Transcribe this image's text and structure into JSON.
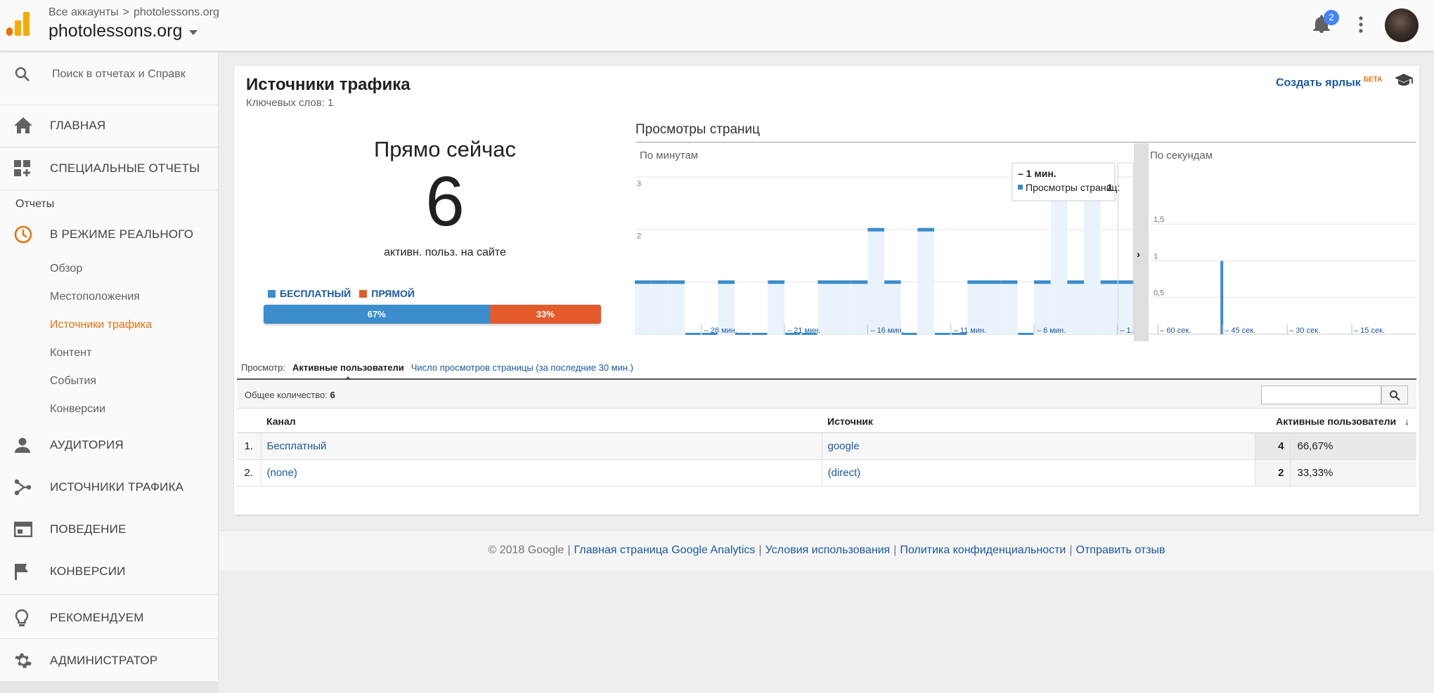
{
  "header": {
    "breadcrumb_all": "Все аккаунты",
    "breadcrumb_sep": ">",
    "breadcrumb_site": "photolessons.org",
    "property": "photolessons.org",
    "notifications_count": "2"
  },
  "sidebar": {
    "search_placeholder": "Поиск в отчетах и Справк",
    "home": "ГЛАВНАЯ",
    "custom_reports": "СПЕЦИАЛЬНЫЕ ОТЧЕТЫ",
    "reports_heading": "Отчеты",
    "realtime": "В РЕЖИМЕ РЕАЛЬНОГО",
    "realtime_items": [
      "Обзор",
      "Местоположения",
      "Источники трафика",
      "Контент",
      "События",
      "Конверсии"
    ],
    "active_item": "Источники трафика",
    "audience": "АУДИТОРИЯ",
    "acquisition": "ИСТОЧНИКИ ТРАФИКА",
    "behavior": "ПОВЕДЕНИЕ",
    "conversions": "КОНВЕРСИИ",
    "discover": "РЕКОМЕНДУЕМ",
    "admin": "АДМИНИСТРАТОР"
  },
  "report": {
    "title": "Источники трафика",
    "keywords": "Ключевых слов: 1",
    "shortcut": "Создать ярлык",
    "shortcut_badge": "БЕТА",
    "now_label": "Прямо сейчас",
    "now_count": "6",
    "now_sub": "активн. польз. на сайте",
    "legend": [
      {
        "label": "БЕСПЛАТНЫЙ",
        "color": "#3b8dcb"
      },
      {
        "label": "ПРЯМОЙ",
        "color": "#e35b2a"
      }
    ],
    "split": [
      {
        "label": "67%",
        "value": 67,
        "color": "#3b8dcb"
      },
      {
        "label": "33%",
        "value": 33,
        "color": "#e35b2a"
      }
    ]
  },
  "chart_data": [
    {
      "type": "bar",
      "title": "Просмотры страниц",
      "subtitle": "По минутам",
      "ylim": [
        0,
        3
      ],
      "y_ticks": [
        "1",
        "2",
        "3"
      ],
      "x_tick_labels": [
        "– 26 мин.",
        "– 21 мин.",
        "– 16 мин.",
        "– 11 мин.",
        "– 6 мин.",
        "– 1..."
      ],
      "x_tick_minutes": [
        26,
        21,
        16,
        11,
        6,
        1
      ],
      "minutes": [
        30,
        29,
        28,
        27,
        26,
        25,
        24,
        23,
        22,
        21,
        20,
        19,
        18,
        17,
        16,
        15,
        14,
        13,
        12,
        11,
        10,
        9,
        8,
        7,
        6,
        5,
        4,
        3,
        2,
        1
      ],
      "values": [
        1,
        1,
        1,
        0,
        0,
        1,
        0,
        0,
        1,
        0,
        0,
        1,
        1,
        1,
        2,
        1,
        0,
        2,
        0,
        0,
        1,
        1,
        1,
        0,
        1,
        3,
        1,
        3,
        1,
        1
      ],
      "color": "#3b8dcb",
      "tooltip": {
        "title": "– 1 мин.",
        "series": "Просмотры страниц:",
        "value": "1"
      }
    },
    {
      "type": "bar",
      "subtitle": "По секундам",
      "ylim": [
        0,
        1.5
      ],
      "y_ticks": [
        "0,5",
        "1",
        "1,5"
      ],
      "x_tick_labels": [
        "– 60 сек.",
        "– 45 сек.",
        "– 30 сек.",
        "– 15 сек."
      ],
      "x_tick_seconds": [
        60,
        45,
        30,
        15
      ],
      "seconds": [
        45
      ],
      "values": [
        1
      ],
      "color": "#3b8dcb"
    }
  ],
  "view": {
    "label": "Просмотр:",
    "active_tab": "Активные пользователи",
    "other_tab": "Число просмотров страницы (за последние 30 мин.)"
  },
  "table": {
    "total_label": "Общее количество:",
    "total_value": "6",
    "headers": {
      "channel": "Канал",
      "source": "Источник",
      "active": "Активные пользователи"
    },
    "rows": [
      {
        "n": "1.",
        "channel": "Бесплатный",
        "source": "google",
        "users": "4",
        "pct": "66,67%"
      },
      {
        "n": "2.",
        "channel": "(none)",
        "source": "(direct)",
        "users": "2",
        "pct": "33,33%"
      }
    ]
  },
  "footer": {
    "copyright": "© 2018 Google",
    "links": [
      "Главная страница Google Analytics",
      "Условия использования",
      "Политика конфиденциальности",
      "Отправить отзыв"
    ],
    "sep": "|"
  }
}
